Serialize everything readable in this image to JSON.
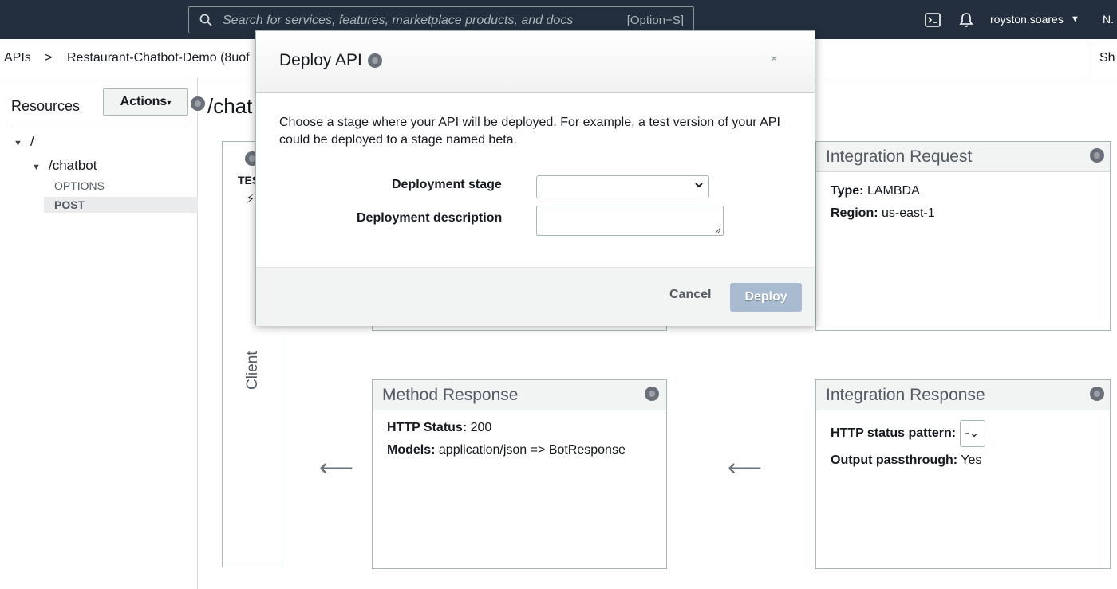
{
  "topnav": {
    "search_placeholder": "Search for services, features, marketplace products, and docs",
    "search_shortcut": "[Option+S]",
    "username": "royston.soares",
    "region": "N."
  },
  "breadcrumb": {
    "apis": "APIs",
    "separator": ">",
    "api_name": "Restaurant-Chatbot-Demo (8uof",
    "right_text": "Sh"
  },
  "sidebar": {
    "title": "Resources",
    "actions_label": "Actions",
    "tree": {
      "root": "/",
      "chatbot": "/chatbot",
      "options": "OPTIONS",
      "post": "POST"
    }
  },
  "main": {
    "path_title": "/chat",
    "client": {
      "label": "Client",
      "test_text": "TES",
      "bolt_glyph": "⚡"
    },
    "integration_request": {
      "title": "Integration Request",
      "type_label": "Type:",
      "type_value": "LAMBDA",
      "region_label": "Region:",
      "region_value": "us-east-1"
    },
    "method_response": {
      "title": "Method Response",
      "status_label": "HTTP Status:",
      "status_value": "200",
      "models_label": "Models:",
      "models_value": "application/json => BotResponse"
    },
    "integration_response": {
      "title": "Integration Response",
      "pattern_label": "HTTP status pattern:",
      "pattern_value": "-",
      "passthrough_label": "Output passthrough:",
      "passthrough_value": "Yes"
    },
    "arrow_glyph": "⟵"
  },
  "modal": {
    "title": "Deploy API",
    "close": "×",
    "description": "Choose a stage where your API will be deployed. For example, a test version of your API could be deployed to a stage named beta.",
    "stage_label": "Deployment stage",
    "stage_value": "",
    "description_label": "Deployment description",
    "description_value": "",
    "cancel_label": "Cancel",
    "deploy_label": "Deploy"
  },
  "colors": {
    "nav_bg": "#232f3e",
    "deploy_disabled": "#a8bbd0",
    "panel_border": "#aab7b8"
  }
}
